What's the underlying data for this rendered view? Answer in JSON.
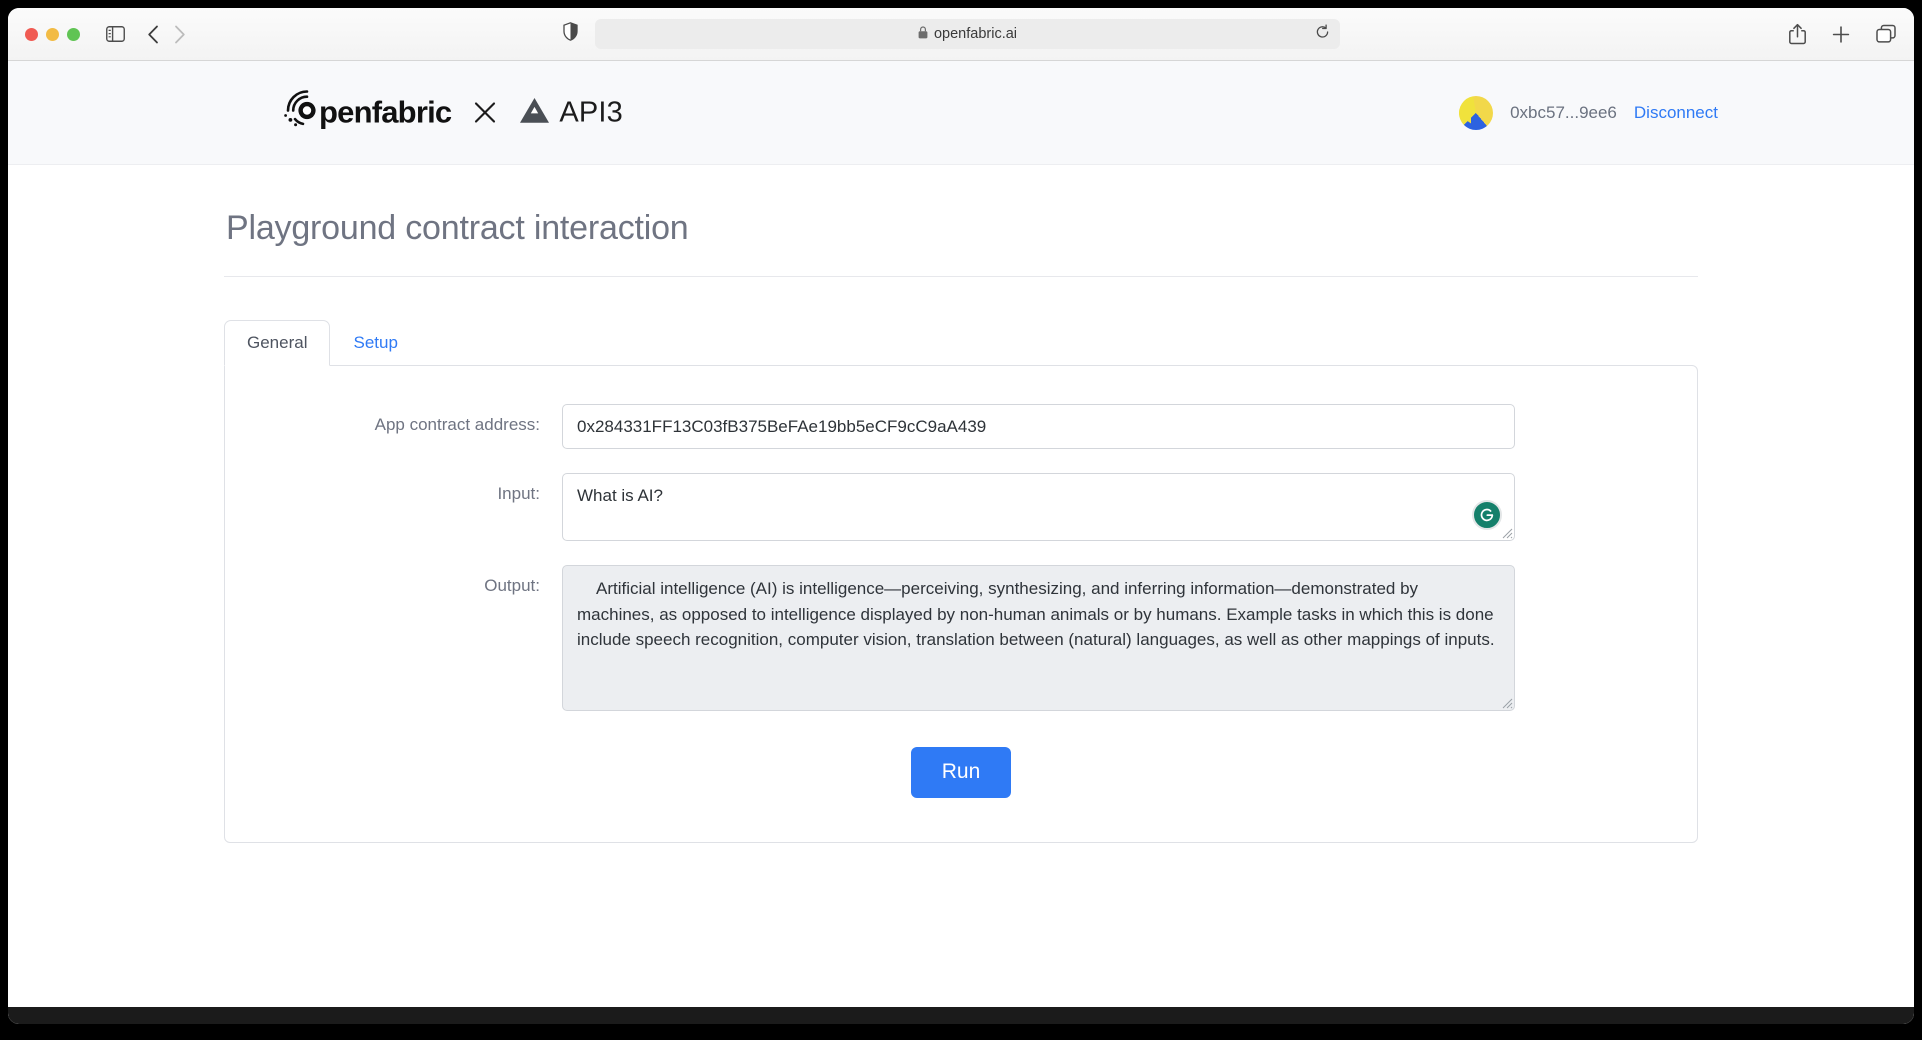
{
  "browser": {
    "traffic_lights": [
      "close",
      "minimize",
      "maximize"
    ],
    "sidebar_toggle_name": "sidebar-toggle",
    "back_label": "‹",
    "forward_label": "›",
    "url": "openfabric.ai",
    "lock_icon": "lock-icon",
    "shield_icon": "privacy-shield-icon",
    "reload_icon": "reload-icon",
    "share_icon": "share-icon",
    "new_tab_icon": "plus-icon",
    "tabs_overview_icon": "tab-overview-icon"
  },
  "header": {
    "brand_openfabric": "penfabric",
    "brand_separator": "✕",
    "brand_api3": "API3",
    "wallet_address": "0xbc57...9ee6",
    "disconnect_label": "Disconnect",
    "avatar_name": "wallet-avatar"
  },
  "main": {
    "page_title": "Playground contract interaction",
    "tabs": [
      {
        "label": "General",
        "active": true
      },
      {
        "label": "Setup",
        "active": false
      }
    ],
    "form": {
      "address_label": "App contract address:",
      "address_value": "0x284331FF13C03fB375BeFAe19bb5eCF9cC9aA439",
      "address_placeholder": "App contract address",
      "input_label": "Input:",
      "input_value": "What is AI?",
      "input_placeholder": "Input",
      "output_label": "Output:",
      "output_value": "Artificial intelligence (AI) is intelligence—perceiving, synthesizing, and inferring information—demonstrated by machines, as opposed to intelligence displayed by non-human animals or by humans. Example tasks in which this is done include speech recognition, computer vision, translation between (natural) languages, as well as other mappings of inputs.",
      "output_placeholder": "Output",
      "grammarly_badge": "G",
      "run_label": "Run"
    }
  },
  "colors": {
    "accent_blue": "#2f7af5",
    "label_gray": "#6f7482",
    "title_gray": "#6f7482",
    "output_bg": "#eceef1",
    "grammarly_green": "#15806b"
  }
}
